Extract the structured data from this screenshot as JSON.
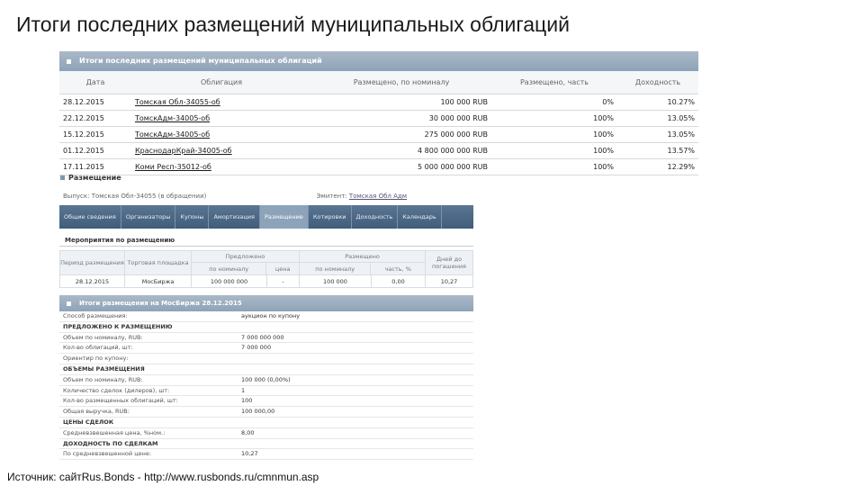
{
  "slide": {
    "title": "Итоги последних размещений муниципальных облигаций",
    "source": "Источник: сайтRus.Bonds - http://www.rusbonds.ru/cmnmun.asp"
  },
  "recent": {
    "header": "Итоги последних размещений муниципальных облигаций",
    "columns": [
      "Дата",
      "Облигация",
      "Размещено, по номиналу",
      "Размещено, часть",
      "Доходность"
    ],
    "rows": [
      {
        "date": "28.12.2015",
        "bond": "Томская Обл-34055-об",
        "amount": "100 000 RUB",
        "part": "0%",
        "yield": "10.27%"
      },
      {
        "date": "22.12.2015",
        "bond": "ТомскАдм-34005-об",
        "amount": "30 000 000 RUB",
        "part": "100%",
        "yield": "13.05%"
      },
      {
        "date": "15.12.2015",
        "bond": "ТомскАдм-34005-об",
        "amount": "275 000 000 RUB",
        "part": "100%",
        "yield": "13.05%"
      },
      {
        "date": "01.12.2015",
        "bond": "КраснодарКрай-34005-об",
        "amount": "4 800 000 000 RUB",
        "part": "100%",
        "yield": "13.57%"
      },
      {
        "date": "17.11.2015",
        "bond": "Коми Респ-35012-об",
        "amount": "5 000 000 000 RUB",
        "part": "100%",
        "yield": "12.29%"
      }
    ]
  },
  "placement": {
    "section_title": "Размещение",
    "issue_label": "Выпуск: Томская Обл-34055 (в обращении)",
    "issuer_label": "Эмитент:",
    "issuer_value": "Томская Обл Адм",
    "tabs": [
      "Общие сведения",
      "Организаторы",
      "Купоны",
      "Амортизация",
      "Размещение",
      "Котировки",
      "Доходность",
      "Календарь"
    ],
    "active_tab": 4,
    "events_title": "Мероприятия по размещению",
    "events_table": {
      "period": "Период размещения",
      "venue": "Торговая площадка",
      "planned": "Предложено",
      "placed": "Размещено",
      "days": "Дней до погашения",
      "nominal": "по номиналу",
      "price": "цена",
      "placed_nominal": "по номиналу",
      "part": "часть, %",
      "row": {
        "period": "28.12.2015",
        "venue": "МосБиржа",
        "nominal": "100 000 000",
        "price": "-",
        "placed_nominal": "100 000",
        "part": "0,00",
        "days": "10,27"
      }
    },
    "results_header": "Итоги размещения на МосБиржа 28.12.2015",
    "results": [
      {
        "k": "Способ размещения:",
        "v": "аукцион по купону",
        "grp": false
      },
      {
        "k": "ПРЕДЛОЖЕНО К РАЗМЕЩЕНИЮ",
        "v": "",
        "grp": true
      },
      {
        "k": "Объем по номиналу, RUB:",
        "v": "7 000 000 000",
        "grp": false
      },
      {
        "k": "Кол-во облигаций, шт:",
        "v": "7 000 000",
        "grp": false
      },
      {
        "k": "Ориентир по купону:",
        "v": "",
        "grp": false
      },
      {
        "k": "ОБЪЕМЫ РАЗМЕЩЕНИЯ",
        "v": "",
        "grp": true
      },
      {
        "k": "Объем по номиналу, RUB:",
        "v": "100 000 (0,00%)",
        "grp": false
      },
      {
        "k": "Количество сделок (дилеров), шт:",
        "v": "1",
        "grp": false
      },
      {
        "k": "Кол-во размещенных облигаций, шт:",
        "v": "100",
        "grp": false
      },
      {
        "k": "Общая выручка, RUB:",
        "v": "100 000,00",
        "grp": false
      },
      {
        "k": "ЦЕНЫ СДЕЛОК",
        "v": "",
        "grp": true
      },
      {
        "k": "Средневзвешенная цена, %ном.:",
        "v": "8,00",
        "grp": false
      },
      {
        "k": "ДОХОДНОСТЬ ПО СДЕЛКАМ",
        "v": "",
        "grp": true
      },
      {
        "k": "По средневзвешенной цене:",
        "v": "10,27",
        "grp": false
      }
    ]
  }
}
